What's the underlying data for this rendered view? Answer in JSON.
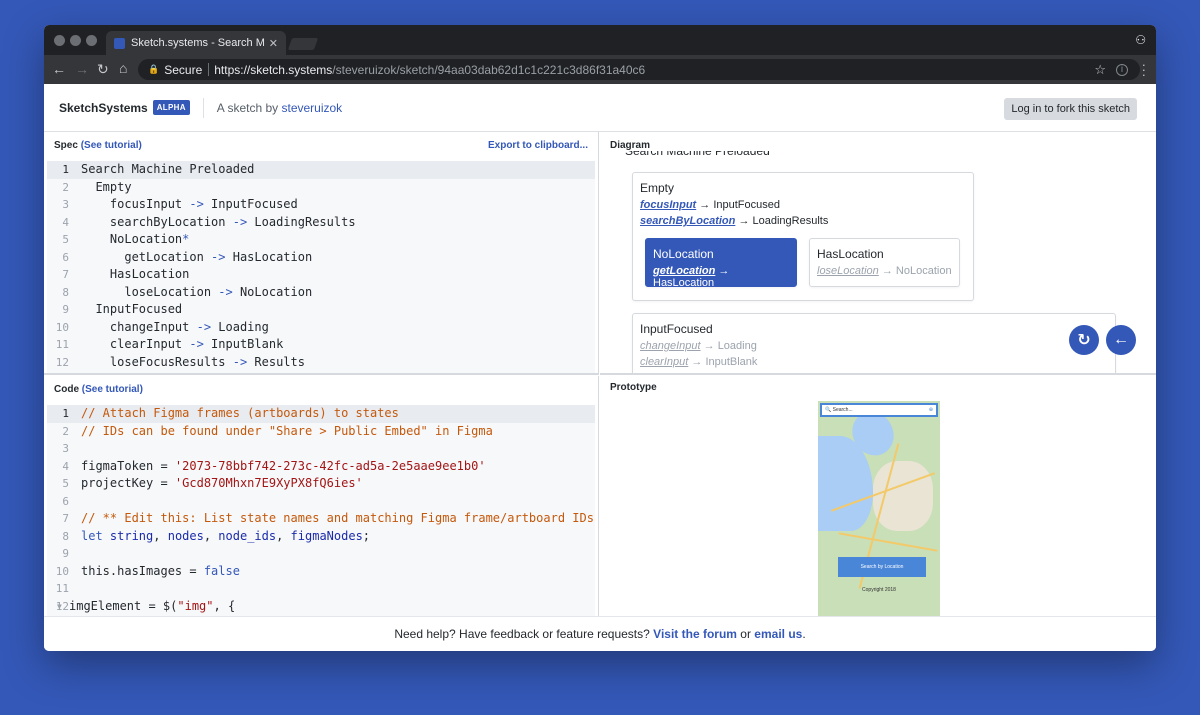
{
  "browser": {
    "tab_title": "Sketch.systems - Search Machi",
    "tab_close": "✕",
    "secure_label": "Secure",
    "url_host": "https://sketch.systems",
    "url_path": "/steveruizok/sketch/94aa03dab62d1c1c221c3d86f31a40c6"
  },
  "header": {
    "brand": "SketchSystems",
    "badge": "ALPHA",
    "byline_prefix": "A sketch by ",
    "author": "steveruizok",
    "login_button": "Log in to fork this sketch"
  },
  "spec": {
    "title": "Spec",
    "tutorial_link": "(See tutorial)",
    "export_link": "Export to clipboard...",
    "lines": [
      {
        "n": "1",
        "text": "Search Machine Preloaded"
      },
      {
        "n": "2",
        "text": "  Empty"
      },
      {
        "n": "3",
        "text": "    focusInput ",
        "arrow": "->",
        "target": " InputFocused"
      },
      {
        "n": "4",
        "text": "    searchByLocation ",
        "arrow": "->",
        "target": " LoadingResults"
      },
      {
        "n": "5",
        "text": "    NoLocation",
        "arrow": "*"
      },
      {
        "n": "6",
        "text": "      getLocation ",
        "arrow": "->",
        "target": " HasLocation"
      },
      {
        "n": "7",
        "text": "    HasLocation"
      },
      {
        "n": "8",
        "text": "      loseLocation ",
        "arrow": "->",
        "target": " NoLocation"
      },
      {
        "n": "9",
        "text": "  InputFocused"
      },
      {
        "n": "10",
        "text": "    changeInput ",
        "arrow": "->",
        "target": " Loading"
      },
      {
        "n": "11",
        "text": "    clearInput ",
        "arrow": "->",
        "target": " InputBlank"
      },
      {
        "n": "12",
        "text": "    loseFocusResults ",
        "arrow": "->",
        "target": " Results"
      }
    ]
  },
  "diagram": {
    "title": "Diagram",
    "machine_name": "Search Machine Preloaded",
    "empty_state": {
      "name": "Empty",
      "transitions": [
        {
          "event": "focusInput",
          "target": "InputFocused"
        },
        {
          "event": "searchByLocation",
          "target": "LoadingResults"
        }
      ]
    },
    "no_location": {
      "name": "NoLocation",
      "event": "getLocation",
      "target": "HasLocation"
    },
    "has_location": {
      "name": "HasLocation",
      "event": "loseLocation",
      "target": "NoLocation"
    },
    "input_focused": {
      "name": "InputFocused",
      "transitions": [
        {
          "event": "changeInput",
          "target": "Loading"
        },
        {
          "event": "clearInput",
          "target": "InputBlank"
        }
      ]
    },
    "arrow_glyph": "→"
  },
  "codepane": {
    "title": "Code",
    "tutorial_link": "(See tutorial)",
    "lines": [
      {
        "n": "1",
        "parts": [
          [
            "cmt",
            "// Attach Figma frames (artboards) to states"
          ]
        ]
      },
      {
        "n": "2",
        "parts": [
          [
            "cmt",
            "// IDs can be found under \"Share > Public Embed\" in Figma"
          ]
        ]
      },
      {
        "n": "3",
        "parts": []
      },
      {
        "n": "4",
        "parts": [
          [
            "",
            "figmaToken = "
          ],
          [
            "str",
            "'2073-78bbf742-273c-42fc-ad5a-2e5aae9ee1b0'"
          ]
        ]
      },
      {
        "n": "5",
        "parts": [
          [
            "",
            "projectKey = "
          ],
          [
            "str",
            "'Gcd870Mhxn7E9XyPX8fQ6ies'"
          ]
        ]
      },
      {
        "n": "6",
        "parts": []
      },
      {
        "n": "7",
        "parts": [
          [
            "cmt",
            "// ** Edit this: List state names and matching Figma frame/artboard IDs"
          ]
        ]
      },
      {
        "n": "8",
        "parts": [
          [
            "kw",
            "let "
          ],
          [
            "var",
            "string"
          ],
          [
            "",
            ", "
          ],
          [
            "var",
            "nodes"
          ],
          [
            "",
            ", "
          ],
          [
            "var",
            "node_ids"
          ],
          [
            "",
            ", "
          ],
          [
            "var",
            "figmaNodes"
          ],
          [
            "",
            ";"
          ]
        ]
      },
      {
        "n": "9",
        "parts": []
      },
      {
        "n": "10",
        "parts": [
          [
            "",
            "this.hasImages = "
          ],
          [
            "kw",
            "false"
          ]
        ]
      },
      {
        "n": "11",
        "parts": []
      },
      {
        "n": "12",
        "parts": [
          [
            "",
            "imgElement = $("
          ],
          [
            "str",
            "\"img\""
          ],
          [
            "",
            ", {"
          ]
        ]
      }
    ]
  },
  "prototype": {
    "title": "Prototype",
    "search_placeholder": "Search...",
    "search_button": "Search by Location",
    "copyright": "Copyright 2018"
  },
  "footer": {
    "prefix": "Need help? Have feedback or feature requests? ",
    "forum_link": "Visit the forum",
    "middle": " or ",
    "email_link": "email us",
    "suffix": "."
  }
}
